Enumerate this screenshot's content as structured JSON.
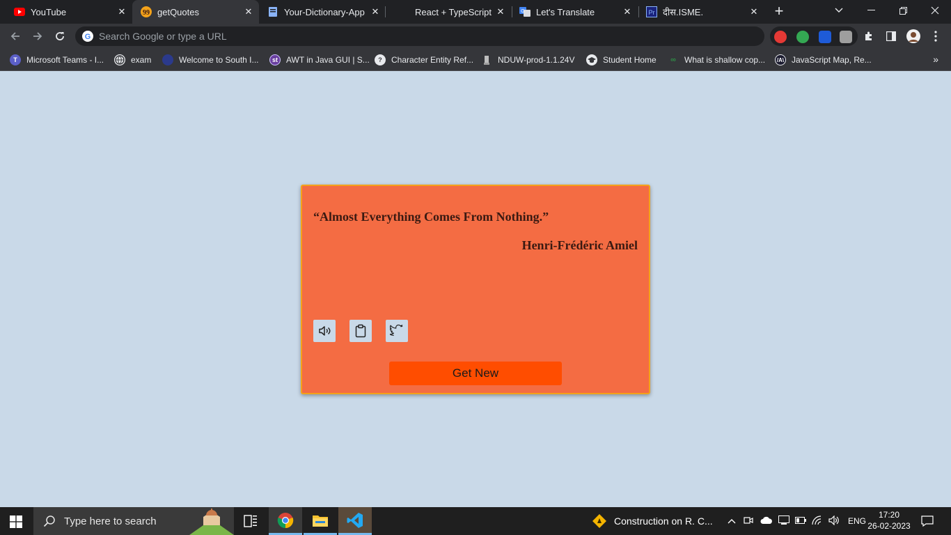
{
  "tabs": [
    {
      "title": "YouTube",
      "icon": "youtube-icon"
    },
    {
      "title": "getQuotes",
      "icon": "quote-favicon"
    },
    {
      "title": "Your-Dictionary-App",
      "icon": "dictionary-favicon"
    },
    {
      "title": "React + TypeScript + I",
      "icon": "react-favicon"
    },
    {
      "title": "Let's Translate",
      "icon": "translate-favicon"
    },
    {
      "title": "दीस.ISME.",
      "icon": "pr-favicon"
    }
  ],
  "active_tab": "getQuotes",
  "omnibox": {
    "placeholder": "Search Google or type a URL"
  },
  "bookmarks": [
    {
      "label": "Microsoft Teams - I...",
      "icon": "teams-icon"
    },
    {
      "label": "exam",
      "icon": "globe-icon"
    },
    {
      "label": "Welcome to South I...",
      "icon": "university-icon"
    },
    {
      "label": "AWT in Java GUI | S...",
      "icon": "st-icon"
    },
    {
      "label": "Character Entity Ref...",
      "icon": "help-icon"
    },
    {
      "label": "NDUW-prod-1.1.24V",
      "icon": "emblem-icon"
    },
    {
      "label": "Student Home",
      "icon": "student-icon"
    },
    {
      "label": "What is shallow cop...",
      "icon": "gfg-icon"
    },
    {
      "label": "JavaScript Map, Re...",
      "icon": "code-icon"
    }
  ],
  "quote": {
    "text": "“Almost Everything Comes From Nothing.”",
    "author": "Henri-Frédéric Amiel",
    "get_new_label": "Get New"
  },
  "colors": {
    "card": "#f46c43",
    "card_border": "#f4a21a",
    "button": "#ff4d00",
    "page_bg": "#c9d9e8"
  },
  "taskbar": {
    "search_placeholder": "Type here to search",
    "notification": "Construction on R. C...",
    "language": "ENG",
    "time": "17:20",
    "date": "26-02-2023"
  }
}
